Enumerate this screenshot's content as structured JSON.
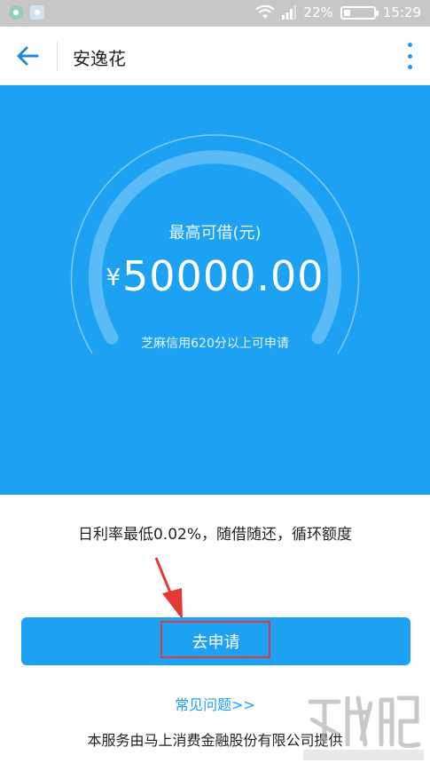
{
  "status_bar": {
    "battery_percent_label": "22%",
    "battery_level": 0.22,
    "time": "15:29"
  },
  "app_bar": {
    "title": "安逸花",
    "back_icon": "arrow-left-icon",
    "more_icon": "more-vertical-icon"
  },
  "hero": {
    "limit_label": "最高可借(元)",
    "currency": "¥",
    "amount": "50000.00",
    "credit_requirement": "芝麻信用620分以上可申请"
  },
  "content": {
    "rate_text": "日利率最低0.02%，随借随还，循环额度",
    "apply_label": "去申请",
    "faq_link": "常见问题>>",
    "provider_text": "本服务由马上消费金融股份有限公司提供"
  },
  "colors": {
    "brand_blue": "#1da1f2",
    "annotation_red": "#e53935"
  }
}
